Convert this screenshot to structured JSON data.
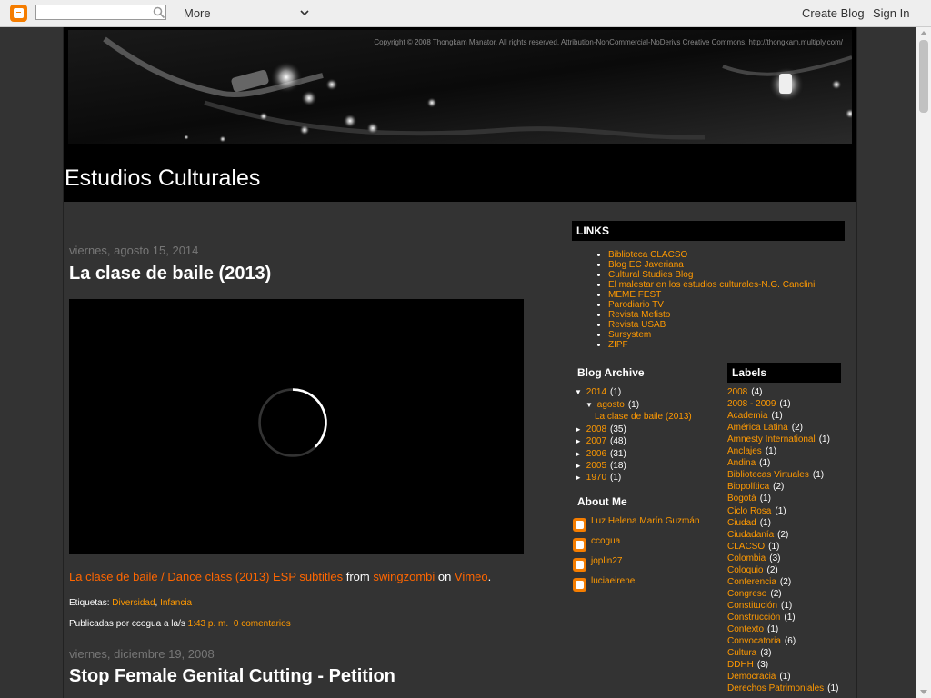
{
  "navbar": {
    "more_label": "More",
    "create_blog": "Create Blog",
    "sign_in": "Sign In"
  },
  "header": {
    "copyright": "Copyright © 2008 Thongkam Manator. All rights reserved. Attribution-NonCommercial-NoDerivs Creative Commons. http://thongkam.multiply.com/",
    "blog_title": "Estudios Culturales"
  },
  "posts": [
    {
      "date": "viernes, agosto 15, 2014",
      "title": "La clase de baile (2013)",
      "embed_link": "La clase de baile / Dance class (2013) ESP subtitles",
      "embed_from": "from",
      "embed_user": "swingzombi",
      "embed_on": "on",
      "embed_site": "Vimeo",
      "embed_end": ".",
      "labels_prefix": "Etiquetas:",
      "labels": [
        "Diversidad",
        "Infancia"
      ],
      "byline_prefix": "Publicadas por ccogua a la/s",
      "time": "1:43 p. m.",
      "comments": "0 comentarios"
    },
    {
      "date": "viernes, diciembre 19, 2008",
      "title": "Stop Female Genital Cutting - Petition"
    }
  ],
  "sidebar": {
    "links_title": "LINKS",
    "links": [
      "Biblioteca CLACSO",
      "Blog EC Javeriana",
      "Cultural Studies Blog",
      "El malestar en los estudios culturales-N.G. Canclini",
      "MEME FEST",
      "Parodiario TV",
      "Revista Mefisto",
      "Revista USAB",
      "Sursystem",
      "ZIPF"
    ],
    "archive_title": "Blog Archive",
    "archive": [
      {
        "arrow": "▼",
        "label": "2014",
        "count": "(1)",
        "indent": 0
      },
      {
        "arrow": "▼",
        "label": "agosto",
        "count": "(1)",
        "indent": 1
      },
      {
        "arrow": "",
        "label": "La clase de baile (2013)",
        "count": "",
        "indent": 2
      },
      {
        "arrow": "►",
        "label": "2008",
        "count": "(35)",
        "indent": 0
      },
      {
        "arrow": "►",
        "label": "2007",
        "count": "(48)",
        "indent": 0
      },
      {
        "arrow": "►",
        "label": "2006",
        "count": "(31)",
        "indent": 0
      },
      {
        "arrow": "►",
        "label": "2005",
        "count": "(18)",
        "indent": 0
      },
      {
        "arrow": "►",
        "label": "1970",
        "count": "(1)",
        "indent": 0
      }
    ],
    "about_title": "About Me",
    "about": [
      "Luz Helena Marín Guzmán",
      "ccogua",
      "joplin27",
      "luciaeirene"
    ],
    "labels_title": "Labels",
    "labels": [
      {
        "name": "2008",
        "count": "(4)"
      },
      {
        "name": "2008 - 2009",
        "count": "(1)"
      },
      {
        "name": "Academia",
        "count": "(1)"
      },
      {
        "name": "América Latina",
        "count": "(2)"
      },
      {
        "name": "Amnesty International",
        "count": "(1)"
      },
      {
        "name": "Anclajes",
        "count": "(1)"
      },
      {
        "name": "Andina",
        "count": "(1)"
      },
      {
        "name": "Bibliotecas Virtuales",
        "count": "(1)"
      },
      {
        "name": "Biopolítica",
        "count": "(2)"
      },
      {
        "name": "Bogotá",
        "count": "(1)"
      },
      {
        "name": "Ciclo Rosa",
        "count": "(1)"
      },
      {
        "name": "Ciudad",
        "count": "(1)"
      },
      {
        "name": "Ciudadanía",
        "count": "(2)"
      },
      {
        "name": "CLACSO",
        "count": "(1)"
      },
      {
        "name": "Colombia",
        "count": "(3)"
      },
      {
        "name": "Coloquio",
        "count": "(2)"
      },
      {
        "name": "Conferencia",
        "count": "(2)"
      },
      {
        "name": "Congreso",
        "count": "(2)"
      },
      {
        "name": "Constitución",
        "count": "(1)"
      },
      {
        "name": "Construcción",
        "count": "(1)"
      },
      {
        "name": "Contexto",
        "count": "(1)"
      },
      {
        "name": "Convocatoria",
        "count": "(6)"
      },
      {
        "name": "Cultura",
        "count": "(3)"
      },
      {
        "name": "DDHH",
        "count": "(3)"
      },
      {
        "name": "Democracia",
        "count": "(1)"
      },
      {
        "name": "Derechos Patrimoniales",
        "count": "(1)"
      }
    ]
  }
}
